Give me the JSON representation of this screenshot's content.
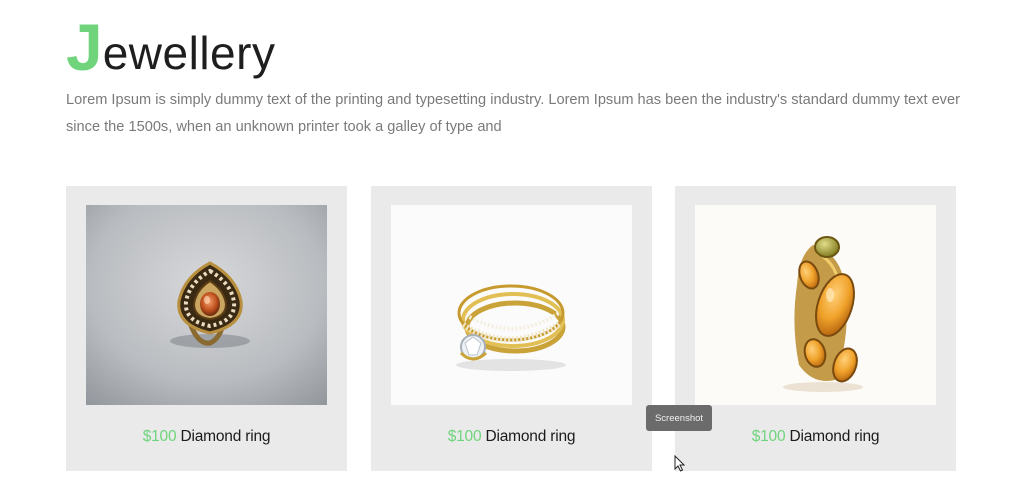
{
  "header": {
    "title_initial": "J",
    "title_rest": "ewellery",
    "intro_text": "Lorem Ipsum is simply dummy text of the printing and typesetting industry. Lorem Ipsum has been the industry's standard dummy text ever since the 1500s, when an unknown printer took a galley of type and"
  },
  "products": [
    {
      "price": "$100",
      "name": "Diamond ring",
      "image_icon": "ring-photo-gem-pendant"
    },
    {
      "price": "$100",
      "name": "Diamond ring",
      "image_icon": "ring-photo-gold-diamond"
    },
    {
      "price": "$100",
      "name": "Diamond ring",
      "image_icon": "ring-photo-amber-stones"
    }
  ],
  "tooltip": {
    "text": "Screenshot"
  },
  "colors": {
    "accent": "#6fd47c",
    "card_bg": "#eaeaea",
    "tooltip_bg": "#6b6b6b"
  }
}
